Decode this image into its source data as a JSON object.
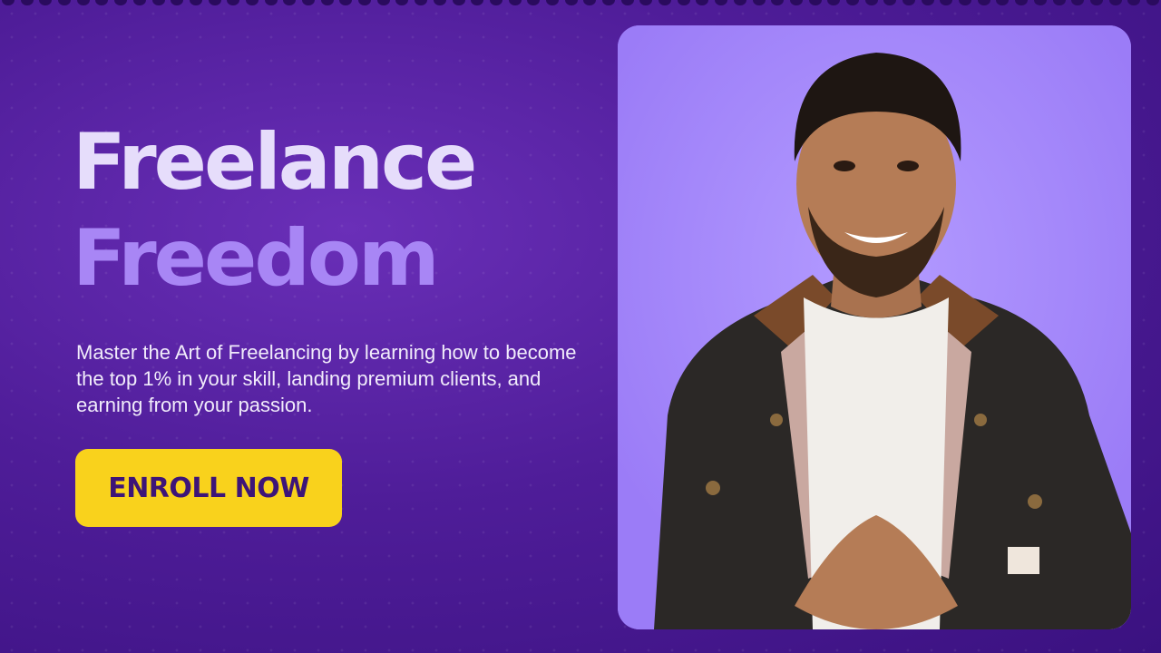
{
  "hero": {
    "title_line_1": "Freelance",
    "title_line_2": "Freedom",
    "description": "Master the Art of Freelancing by learning how to become the top 1% in your skill, landing premium clients, and earning from your passion.",
    "cta_label": "ENROLL NOW"
  },
  "colors": {
    "background": "#4f1d99",
    "title_primary": "#e6ddfb",
    "title_accent": "#a886f5",
    "cta_background": "#f9d21c",
    "cta_text": "#3d1578",
    "photo_background": "#a081fb"
  },
  "photo": {
    "icon": "instructor-portrait"
  }
}
